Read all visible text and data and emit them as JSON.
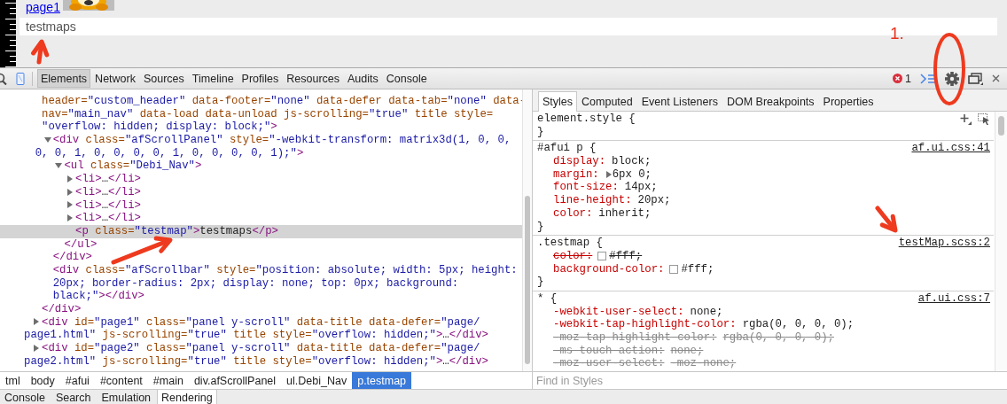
{
  "page": {
    "link": "page1",
    "paragraph": "testmaps"
  },
  "toolbar": {
    "tabs": [
      {
        "label": "Elements",
        "selected": true
      },
      {
        "label": "Network",
        "selected": false
      },
      {
        "label": "Sources",
        "selected": false
      },
      {
        "label": "Timeline",
        "selected": false
      },
      {
        "label": "Profiles",
        "selected": false
      },
      {
        "label": "Resources",
        "selected": false
      },
      {
        "label": "Audits",
        "selected": false
      },
      {
        "label": "Console",
        "selected": false
      }
    ],
    "error_count": "1"
  },
  "dom": [
    {
      "selected": false,
      "lines": [
        [
          {
            "kind": "attr",
            "text": "header="
          },
          {
            "kind": "value",
            "text": "\"custom_header\""
          },
          {
            "kind": "attr",
            "text": " data-footer="
          },
          {
            "kind": "value",
            "text": "\"none\""
          },
          {
            "kind": "attr",
            "text": " data-defer data-tab="
          },
          {
            "kind": "value",
            "text": "\"none\""
          },
          {
            "kind": "attr",
            "text": " data-"
          }
        ],
        [
          {
            "kind": "attr",
            "text": "nav="
          },
          {
            "kind": "value",
            "text": "\"main_nav\""
          },
          {
            "kind": "attr",
            "text": " data-load data-unload js-scrolling="
          },
          {
            "kind": "value",
            "text": "\"true\""
          },
          {
            "kind": "attr",
            "text": " title style="
          }
        ],
        [
          {
            "kind": "value",
            "text": "\"overflow: hidden; display: block;\""
          },
          {
            "kind": "tag",
            "text": ">"
          }
        ]
      ],
      "children": [
        {
          "selected": false,
          "expanded": true,
          "lines": [
            [
              {
                "kind": "tag",
                "text": "<div"
              },
              {
                "kind": "attr",
                "text": " class="
              },
              {
                "kind": "value",
                "text": "\"afScrollPanel\""
              },
              {
                "kind": "attr",
                "text": " style="
              },
              {
                "kind": "value",
                "text": "\"-webkit-transform: matrix3d(1, 0, 0,"
              }
            ],
            [
              {
                "kind": "value",
                "text": "0, 0, 1, 0, 0, 0, 0, 1, 0, 0, 0, 0, 1);\""
              },
              {
                "kind": "tag",
                "text": ">"
              }
            ]
          ],
          "children": [
            {
              "selected": false,
              "expanded": true,
              "lines": [
                [
                  {
                    "kind": "tag",
                    "text": "<ul"
                  },
                  {
                    "kind": "attr",
                    "text": " class="
                  },
                  {
                    "kind": "value",
                    "text": "\"Debi_Nav\""
                  },
                  {
                    "kind": "tag",
                    "text": ">"
                  }
                ]
              ],
              "children": [
                {
                  "selected": false,
                  "expanded": false,
                  "lines": [
                    [
                      {
                        "kind": "tag",
                        "text": "<li>"
                      },
                      {
                        "kind": "text",
                        "text": "…"
                      },
                      {
                        "kind": "tag",
                        "text": "</li>"
                      }
                    ]
                  ]
                },
                {
                  "selected": false,
                  "expanded": false,
                  "lines": [
                    [
                      {
                        "kind": "tag",
                        "text": "<li>"
                      },
                      {
                        "kind": "text",
                        "text": "…"
                      },
                      {
                        "kind": "tag",
                        "text": "</li>"
                      }
                    ]
                  ]
                },
                {
                  "selected": false,
                  "expanded": false,
                  "lines": [
                    [
                      {
                        "kind": "tag",
                        "text": "<li>"
                      },
                      {
                        "kind": "text",
                        "text": "…"
                      },
                      {
                        "kind": "tag",
                        "text": "</li>"
                      }
                    ]
                  ]
                },
                {
                  "selected": false,
                  "expanded": false,
                  "lines": [
                    [
                      {
                        "kind": "tag",
                        "text": "<li>"
                      },
                      {
                        "kind": "text",
                        "text": "…"
                      },
                      {
                        "kind": "tag",
                        "text": "</li>"
                      }
                    ]
                  ]
                },
                {
                  "selected": true,
                  "lines": [
                    [
                      {
                        "kind": "tag",
                        "text": "<p"
                      },
                      {
                        "kind": "attr",
                        "text": " class="
                      },
                      {
                        "kind": "value",
                        "text": "\"testmap\""
                      },
                      {
                        "kind": "tag",
                        "text": ">"
                      },
                      {
                        "kind": "text",
                        "text": "testmaps"
                      },
                      {
                        "kind": "tag",
                        "text": "</p>"
                      }
                    ]
                  ]
                }
              ],
              "closing": [
                {
                  "kind": "tag",
                  "text": "</ul>"
                }
              ]
            }
          ],
          "closing": [
            {
              "kind": "tag",
              "text": "</div>"
            }
          ]
        },
        {
          "selected": false,
          "lines": [
            [
              {
                "kind": "tag",
                "text": "<div"
              },
              {
                "kind": "attr",
                "text": " class="
              },
              {
                "kind": "value",
                "text": "\"afScrollbar\""
              },
              {
                "kind": "attr",
                "text": " style="
              },
              {
                "kind": "value",
                "text": "\"position: absolute; width: 5px; height:"
              }
            ],
            [
              {
                "kind": "value",
                "text": "20px; border-radius: 2px; display: none; top: 0px; background:"
              }
            ],
            [
              {
                "kind": "value",
                "text": "black;\""
              },
              {
                "kind": "tag",
                "text": "></div>"
              }
            ]
          ]
        }
      ],
      "closing": [
        {
          "kind": "tag",
          "text": "</div>"
        }
      ]
    },
    {
      "selected": false,
      "expanded": false,
      "lines": [
        [
          {
            "kind": "tag",
            "text": "<div"
          },
          {
            "kind": "attr",
            "text": " id="
          },
          {
            "kind": "value",
            "text": "\"page1\""
          },
          {
            "kind": "attr",
            "text": " class="
          },
          {
            "kind": "value",
            "text": "\"panel y-scroll\""
          },
          {
            "kind": "attr",
            "text": " data-title data-defer="
          },
          {
            "kind": "value",
            "text": "\"page/"
          }
        ],
        [
          {
            "kind": "value",
            "text": "page1.html\""
          },
          {
            "kind": "attr",
            "text": " js-scrolling="
          },
          {
            "kind": "value",
            "text": "\"true\""
          },
          {
            "kind": "attr",
            "text": " title style="
          },
          {
            "kind": "value",
            "text": "\"overflow: hidden;\""
          },
          {
            "kind": "tag",
            "text": ">"
          },
          {
            "kind": "text",
            "text": "…"
          },
          {
            "kind": "tag",
            "text": "</div>"
          }
        ]
      ]
    },
    {
      "selected": false,
      "expanded": false,
      "lines": [
        [
          {
            "kind": "tag",
            "text": "<div"
          },
          {
            "kind": "attr",
            "text": " id="
          },
          {
            "kind": "value",
            "text": "\"page2\""
          },
          {
            "kind": "attr",
            "text": " class="
          },
          {
            "kind": "value",
            "text": "\"panel y-scroll\""
          },
          {
            "kind": "attr",
            "text": " data-title data-defer="
          },
          {
            "kind": "value",
            "text": "\"page/"
          }
        ],
        [
          {
            "kind": "value",
            "text": "page2.html\""
          },
          {
            "kind": "attr",
            "text": " js-scrolling="
          },
          {
            "kind": "value",
            "text": "\"true\""
          },
          {
            "kind": "attr",
            "text": " title style="
          },
          {
            "kind": "value",
            "text": "\"overflow: hidden;\""
          },
          {
            "kind": "tag",
            "text": ">"
          },
          {
            "kind": "text",
            "text": "…"
          },
          {
            "kind": "tag",
            "text": "</div>"
          }
        ]
      ]
    }
  ],
  "breadcrumbs": [
    {
      "label": "tml",
      "selected": false
    },
    {
      "label": "body",
      "selected": false
    },
    {
      "label": "#afui",
      "selected": false
    },
    {
      "label": "#content",
      "selected": false
    },
    {
      "label": "#main",
      "selected": false
    },
    {
      "label": "div.afScrollPanel",
      "selected": false
    },
    {
      "label": "ul.Debi_Nav",
      "selected": false
    },
    {
      "label": "p.testmap",
      "selected": true
    }
  ],
  "sidebar": {
    "tabs": [
      {
        "label": "Styles",
        "selected": true
      },
      {
        "label": "Computed",
        "selected": false
      },
      {
        "label": "Event Listeners",
        "selected": false
      },
      {
        "label": "DOM Breakpoints",
        "selected": false
      },
      {
        "label": "Properties",
        "selected": false
      }
    ],
    "rules": [
      {
        "kind": "inline",
        "selector": "element.style {",
        "close": "}"
      },
      {
        "kind": "rule",
        "selector": "#afui p {",
        "source": "af.ui.css:41",
        "close": "}",
        "properties": [
          {
            "name": "display:",
            "value": "block;",
            "overridden": false,
            "unsupported": false
          },
          {
            "name": "margin:",
            "value": "6px 0;",
            "overridden": false,
            "unsupported": false,
            "expanded": false
          },
          {
            "name": "font-size:",
            "value": "14px;",
            "overridden": false,
            "unsupported": false
          },
          {
            "name": "line-height:",
            "value": "20px;",
            "overridden": false,
            "unsupported": false
          },
          {
            "name": "color:",
            "value": "inherit;",
            "overridden": false,
            "unsupported": false
          }
        ]
      },
      {
        "kind": "rule",
        "selector": ".testmap {",
        "source": "testMap.scss:2",
        "close": "}",
        "properties": [
          {
            "name": "color:",
            "value": "#fff;",
            "overridden": true,
            "unsupported": false,
            "swatch": true
          },
          {
            "name": "background-color:",
            "value": "#fff;",
            "overridden": false,
            "unsupported": false,
            "swatch": true
          }
        ]
      },
      {
        "kind": "rule",
        "selector": "* {",
        "source": "af.ui.css:7",
        "properties": [
          {
            "name": "-webkit-user-select:",
            "value": "none;",
            "overridden": false,
            "unsupported": false
          },
          {
            "name": "-webkit-tap-highlight-color:",
            "value": "rgba(0, 0, 0, 0);",
            "overridden": false,
            "unsupported": false
          },
          {
            "name": "-moz-tap-highlight-color:",
            "value": "rgba(0, 0, 0, 0);",
            "overridden": true,
            "unsupported": true
          },
          {
            "name": "-ms-touch-action:",
            "value": "none;",
            "overridden": true,
            "unsupported": true
          },
          {
            "name": "-moz-user-select:",
            "value": "-moz-none;",
            "overridden": true,
            "unsupported": true
          }
        ]
      }
    ],
    "filter": {
      "placeholder": "Find in Styles"
    }
  },
  "drawer": {
    "tabs": [
      {
        "label": "Console",
        "selected": false
      },
      {
        "label": "Search",
        "selected": false
      },
      {
        "label": "Emulation",
        "selected": false
      },
      {
        "label": "Rendering",
        "selected": true
      }
    ]
  },
  "annotations": {
    "label": "1."
  }
}
